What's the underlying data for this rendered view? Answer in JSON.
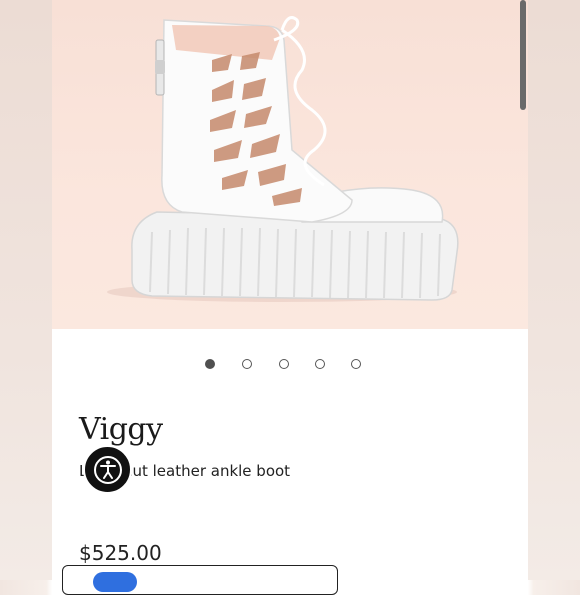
{
  "product": {
    "name": "Viggy",
    "subtitle": "Laser-cut leather ankle boot",
    "price": "$525.00"
  },
  "gallery": {
    "image_alt": "White laser-cut leather platform ankle boot",
    "dots": [
      {
        "active": true
      },
      {
        "active": false
      },
      {
        "active": false
      },
      {
        "active": false
      },
      {
        "active": false
      }
    ]
  },
  "accessibility": {
    "icon": "accessibility-icon"
  },
  "colors": {
    "hero_bg": "#fbe6dd",
    "accent_blue": "#2f6fdf",
    "dot_active": "#505050"
  }
}
